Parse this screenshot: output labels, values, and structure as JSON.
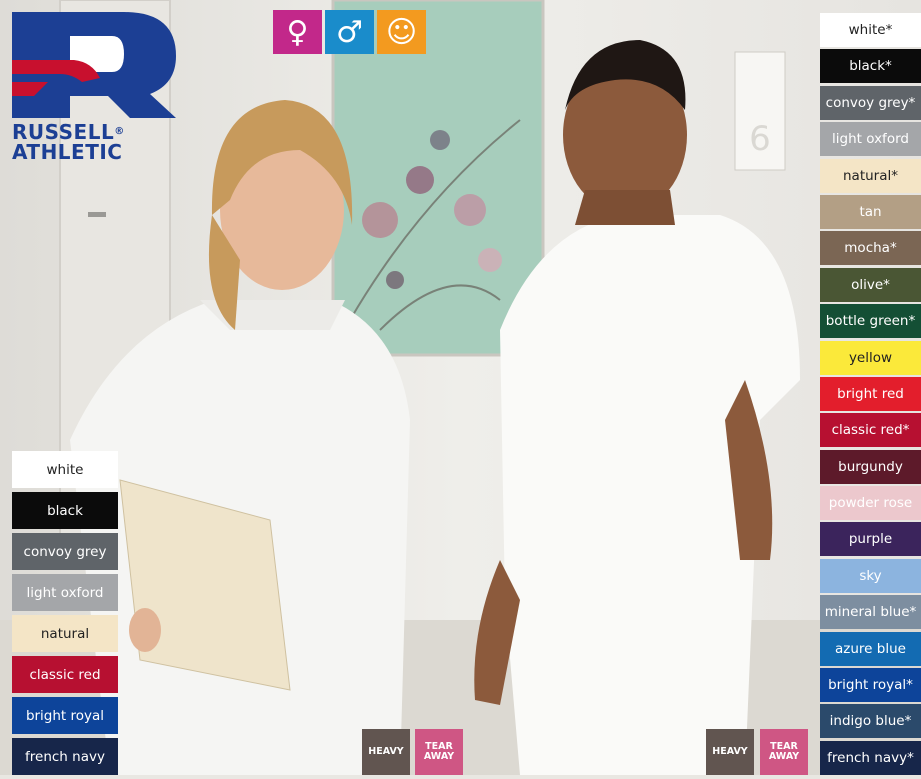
{
  "brand": {
    "line1": "RUSSELL",
    "reg": "®",
    "line2": "ATHLETIC",
    "blue": "#1c3f94",
    "red": "#c8102e"
  },
  "gender_icons": [
    {
      "glyph": "♀",
      "color": "#c2288a",
      "name": "female-icon"
    },
    {
      "glyph": "♂",
      "color": "#1a8ccb",
      "name": "male-icon"
    },
    {
      "glyph": "☺",
      "color": "#f39a1f",
      "name": "unisex-icon"
    }
  ],
  "right_colors": [
    {
      "label": "white*",
      "bg": "#ffffff",
      "fg": "#222222"
    },
    {
      "label": "black*",
      "bg": "#0b0b0b",
      "fg": "#ffffff"
    },
    {
      "label": "convoy grey*",
      "bg": "#5f6469",
      "fg": "#ffffff"
    },
    {
      "label": "light oxford",
      "bg": "#a4a6a9",
      "fg": "#ffffff"
    },
    {
      "label": "natural*",
      "bg": "#f4e5c6",
      "fg": "#222222"
    },
    {
      "label": "tan",
      "bg": "#b39f85",
      "fg": "#ffffff"
    },
    {
      "label": "mocha*",
      "bg": "#7b6654",
      "fg": "#ffffff"
    },
    {
      "label": "olive*",
      "bg": "#4a5634",
      "fg": "#ffffff"
    },
    {
      "label": "bottle green*",
      "bg": "#144f35",
      "fg": "#ffffff"
    },
    {
      "label": "yellow",
      "bg": "#fbe93a",
      "fg": "#222222"
    },
    {
      "label": "bright red",
      "bg": "#e31e2c",
      "fg": "#ffffff"
    },
    {
      "label": "classic red*",
      "bg": "#b71031",
      "fg": "#ffffff"
    },
    {
      "label": "burgundy",
      "bg": "#5d1a2a",
      "fg": "#ffffff"
    },
    {
      "label": "powder rose",
      "bg": "#ecc8cd",
      "fg": "#ffffff"
    },
    {
      "label": "purple",
      "bg": "#3b245c",
      "fg": "#ffffff"
    },
    {
      "label": "sky",
      "bg": "#8cb4df",
      "fg": "#ffffff"
    },
    {
      "label": "mineral blue*",
      "bg": "#7d8ea0",
      "fg": "#ffffff"
    },
    {
      "label": "azure blue",
      "bg": "#136bb2",
      "fg": "#ffffff"
    },
    {
      "label": "bright royal*",
      "bg": "#0d449a",
      "fg": "#ffffff"
    },
    {
      "label": "indigo blue*",
      "bg": "#2b4a6b",
      "fg": "#ffffff"
    },
    {
      "label": "french navy*",
      "bg": "#17264a",
      "fg": "#ffffff"
    }
  ],
  "left_colors": [
    {
      "label": "white",
      "bg": "#ffffff",
      "fg": "#222222"
    },
    {
      "label": "black",
      "bg": "#0b0b0b",
      "fg": "#ffffff"
    },
    {
      "label": "convoy grey",
      "bg": "#5f6469",
      "fg": "#ffffff"
    },
    {
      "label": "light oxford",
      "bg": "#a4a6a9",
      "fg": "#ffffff"
    },
    {
      "label": "natural",
      "bg": "#f4e5c6",
      "fg": "#222222"
    },
    {
      "label": "classic red",
      "bg": "#b71031",
      "fg": "#ffffff"
    },
    {
      "label": "bright royal",
      "bg": "#0d449a",
      "fg": "#ffffff"
    },
    {
      "label": "french navy",
      "bg": "#17264a",
      "fg": "#ffffff"
    }
  ],
  "tags": [
    {
      "label": "HEAVY",
      "bg": "#615550"
    },
    {
      "label": "TEAR AWAY",
      "bg": "#cf5684"
    },
    {
      "label": "HEAVY",
      "bg": "#615550"
    },
    {
      "label": "TEAR AWAY",
      "bg": "#cf5684"
    }
  ]
}
